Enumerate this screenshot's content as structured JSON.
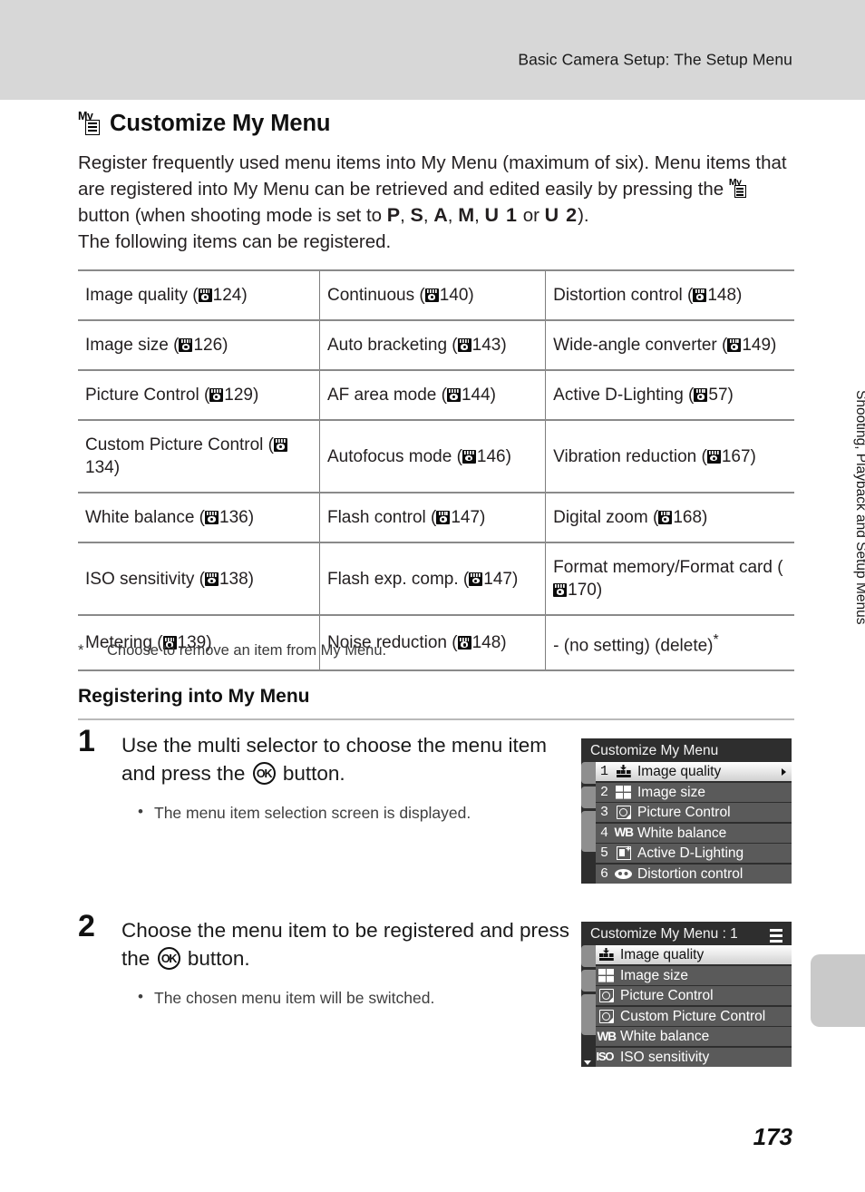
{
  "header": {
    "running_title": "Basic Camera Setup: The Setup Menu"
  },
  "heading": {
    "icon": "my-menu-button-icon",
    "title": "Customize My Menu"
  },
  "intro": {
    "line1": "Register frequently used menu items into My Menu (maximum of six). Menu items",
    "line2": "that are registered into My Menu can be retrieved and edited easily by pressing the",
    "line3_before": "button (when shooting mode is set to",
    "modes": [
      "P",
      "S",
      "A",
      "M",
      "U 1",
      "U 2"
    ],
    "or_word": "or",
    "line3_after": ").",
    "line4": "The following items can be registered."
  },
  "table": {
    "rows": [
      [
        {
          "label": "Image quality (",
          "ref": "124",
          "tail": ")"
        },
        {
          "label": "Continuous (",
          "ref": "140",
          "tail": ")"
        },
        {
          "label": "Distortion control (",
          "ref": "148",
          "tail": ")"
        }
      ],
      [
        {
          "label": "Image size (",
          "ref": "126",
          "tail": ")"
        },
        {
          "label": "Auto bracketing (",
          "ref": "143",
          "tail": ")"
        },
        {
          "label": "Wide-angle converter (",
          "ref": "149",
          "tail": ")"
        }
      ],
      [
        {
          "label": "Picture Control (",
          "ref": "129",
          "tail": ")"
        },
        {
          "label": "AF area mode (",
          "ref": "144",
          "tail": ")"
        },
        {
          "label": "Active D-Lighting (",
          "ref": "57",
          "tail": ")"
        }
      ],
      [
        {
          "label": "Custom Picture Control (",
          "ref": "134",
          "tail": ")"
        },
        {
          "label": "Autofocus mode (",
          "ref": "146",
          "tail": ")"
        },
        {
          "label": "Vibration reduction (",
          "ref": "167",
          "tail": ")"
        }
      ],
      [
        {
          "label": "White balance (",
          "ref": "136",
          "tail": ")"
        },
        {
          "label": "Flash control (",
          "ref": "147",
          "tail": ")"
        },
        {
          "label": "Digital zoom (",
          "ref": "168",
          "tail": ")"
        }
      ],
      [
        {
          "label": "ISO sensitivity (",
          "ref": "138",
          "tail": ")"
        },
        {
          "label": "Flash exp. comp. (",
          "ref": "147",
          "tail": ")"
        },
        {
          "label": "Format memory/Format card (",
          "ref": "170",
          "tail": ")"
        }
      ],
      [
        {
          "label": "Metering (",
          "ref": "139",
          "tail": ")"
        },
        {
          "label": "Noise reduction (",
          "ref": "148",
          "tail": ")"
        },
        {
          "label": "- (no setting) (delete)",
          "ref": "",
          "tail": "",
          "sup": "*"
        }
      ]
    ]
  },
  "footnote": {
    "marker": "*",
    "text": "Choose to remove an item from My Menu."
  },
  "subheading": {
    "title": "Registering into My Menu"
  },
  "steps": [
    {
      "number": "1",
      "lead_before": "Use the multi selector to choose the menu item and press the",
      "lead_after": "button.",
      "ok_label": "OK",
      "bullet": "The menu item selection screen is displayed."
    },
    {
      "number": "2",
      "lead_before": "Choose the menu item to be registered and press the",
      "lead_after": "button.",
      "ok_label": "OK",
      "bullet": "The chosen menu item will be switched."
    }
  ],
  "lcd1": {
    "title": "Customize My Menu",
    "items": [
      {
        "index": "1",
        "icon": "image-quality-icon",
        "label": "Image quality",
        "selected": true,
        "arrow": true
      },
      {
        "index": "2",
        "icon": "image-size-icon",
        "label": "Image size",
        "selected": false,
        "arrow": false
      },
      {
        "index": "3",
        "icon": "picture-control-icon",
        "label": "Picture Control",
        "selected": false,
        "arrow": false
      },
      {
        "index": "4",
        "icon": "white-balance-icon",
        "label": "White balance",
        "selected": false,
        "arrow": false
      },
      {
        "index": "5",
        "icon": "active-d-lighting-icon",
        "label": "Active D-Lighting",
        "selected": false,
        "arrow": false
      },
      {
        "index": "6",
        "icon": "distortion-control-icon",
        "label": "Distortion control",
        "selected": false,
        "arrow": false
      }
    ]
  },
  "lcd2": {
    "title": "Customize My Menu : 1",
    "items": [
      {
        "index": "",
        "icon": "image-quality-icon",
        "label": "Image quality",
        "selected": true,
        "arrow": false
      },
      {
        "index": "",
        "icon": "image-size-icon",
        "label": "Image size",
        "selected": false,
        "arrow": false
      },
      {
        "index": "",
        "icon": "picture-control-icon",
        "label": "Picture Control",
        "selected": false,
        "arrow": false
      },
      {
        "index": "",
        "icon": "custom-picture-control-icon",
        "label": "Custom Picture Control",
        "selected": false,
        "arrow": false
      },
      {
        "index": "",
        "icon": "white-balance-icon",
        "label": "White balance",
        "selected": false,
        "arrow": false
      },
      {
        "index": "",
        "icon": "iso-sensitivity-icon",
        "label": "ISO sensitivity",
        "selected": false,
        "arrow": false
      }
    ]
  },
  "side_tab": {
    "text": "Shooting, Playback and Setup Menus"
  },
  "page_number": "173",
  "colors": {
    "header_band": "#d7d7d7",
    "lcd_background": "#2e2e2e",
    "lcd_row": "#5a5a5a",
    "lcd_selected": "#ffffff",
    "table_border": "#8a8a8a",
    "side_tab": "#c9c9c9"
  }
}
